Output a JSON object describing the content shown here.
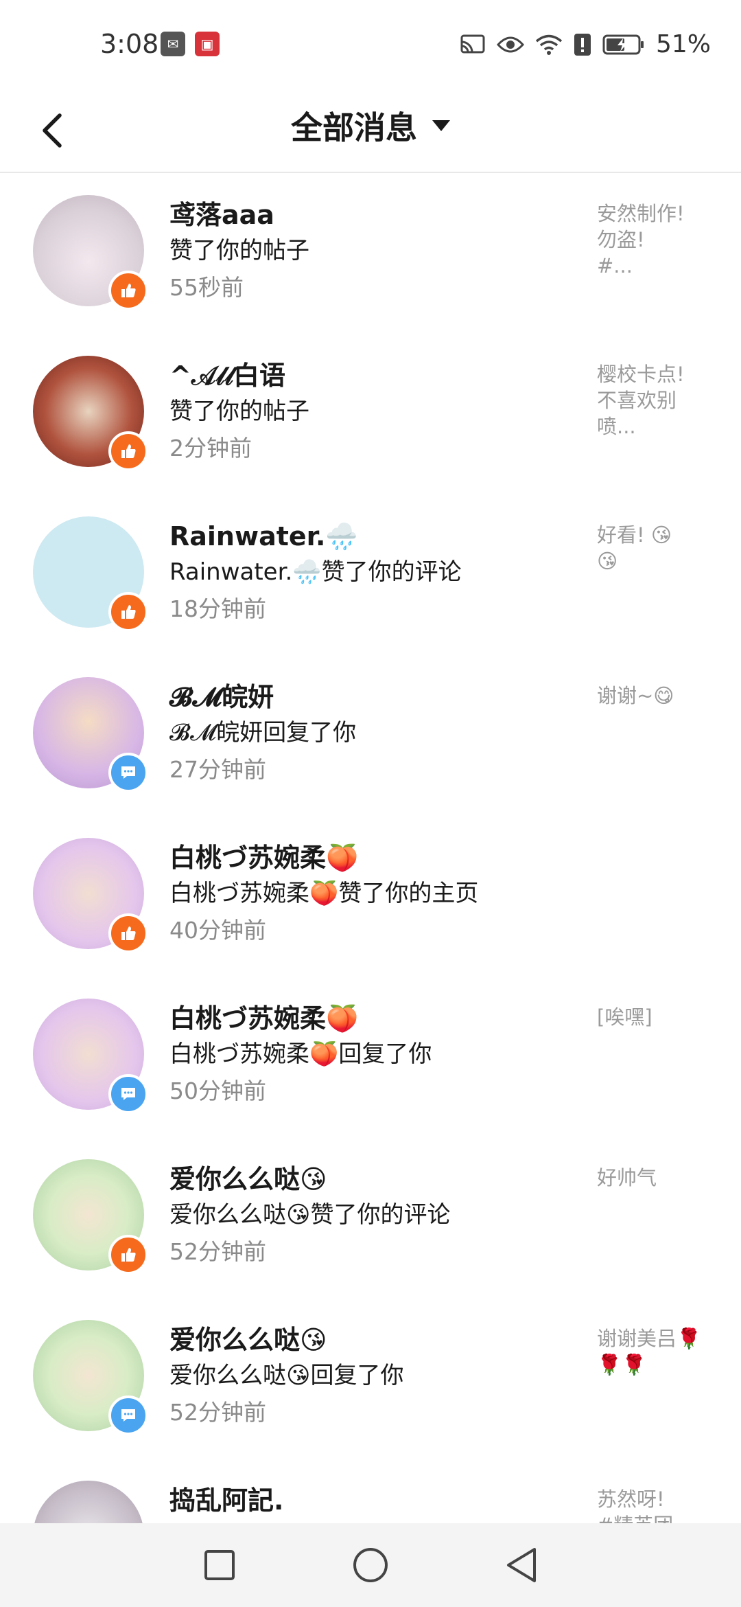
{
  "status_bar": {
    "time": "3:08",
    "battery": "51%"
  },
  "header": {
    "title": "全部消息"
  },
  "messages": [
    {
      "name": "鸢落aaa",
      "action": "赞了你的帖子",
      "time": "55秒前",
      "preview": "安然制作!\n勿盗!\n#...",
      "type": "like",
      "avatar": "av-1"
    },
    {
      "name": "^𝒜𝓁𝓁白语",
      "action": "赞了你的帖子",
      "time": "2分钟前",
      "preview": "樱校卡点!\n不喜欢别\n喷...",
      "type": "like",
      "avatar": "av-2"
    },
    {
      "name": "Rainwater.🌧️",
      "action": "Rainwater.🌧️赞了你的评论",
      "time": "18分钟前",
      "preview": "好看! 😘\n😘",
      "type": "like",
      "avatar": "av-3"
    },
    {
      "name": "𝓑𝓜皖妍",
      "action": "𝓑𝓜皖妍回复了你",
      "time": "27分钟前",
      "preview": "谢谢~😋",
      "type": "reply",
      "avatar": "av-4"
    },
    {
      "name": "白桃づ苏婉柔🍑",
      "action": "白桃づ苏婉柔🍑赞了你的主页",
      "time": "40分钟前",
      "preview": "",
      "type": "like",
      "avatar": "av-5"
    },
    {
      "name": "白桃づ苏婉柔🍑",
      "action": "白桃づ苏婉柔🍑回复了你",
      "time": "50分钟前",
      "preview": "[唉嘿]",
      "type": "reply",
      "avatar": "av-5"
    },
    {
      "name": "爱你么么哒😘",
      "action": "爱你么么哒😘赞了你的评论",
      "time": "52分钟前",
      "preview": "好帅气",
      "type": "like",
      "avatar": "av-6"
    },
    {
      "name": "爱你么么哒😘",
      "action": "爱你么么哒😘回复了你",
      "time": "52分钟前",
      "preview": "谢谢美吕🌹\n🌹🌹",
      "type": "reply",
      "avatar": "av-6"
    },
    {
      "name": "捣乱阿記.",
      "action": "",
      "time": "",
      "preview": "苏然呀!\n#精英团",
      "type": "like",
      "avatar": "av-7"
    }
  ],
  "colors": {
    "like_badge": "#f56a1c",
    "reply_badge": "#4aa4f0"
  }
}
